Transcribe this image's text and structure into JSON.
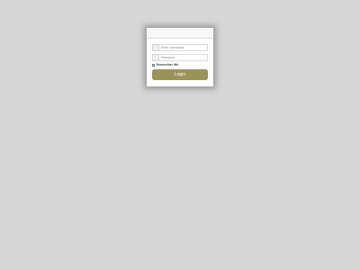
{
  "login": {
    "username_placeholder": "Enter Username",
    "username_value": "",
    "password_placeholder": "Password",
    "password_value": "",
    "remember_label": "Remember Me",
    "remember_checked": false,
    "submit_label": "Login"
  },
  "colors": {
    "background": "#d6d6d6",
    "card": "#ffffff",
    "button": "#9a9458",
    "button_text": "#ffffff"
  },
  "icons": {
    "username_icon": "user-icon",
    "password_icon": "lock-icon"
  }
}
